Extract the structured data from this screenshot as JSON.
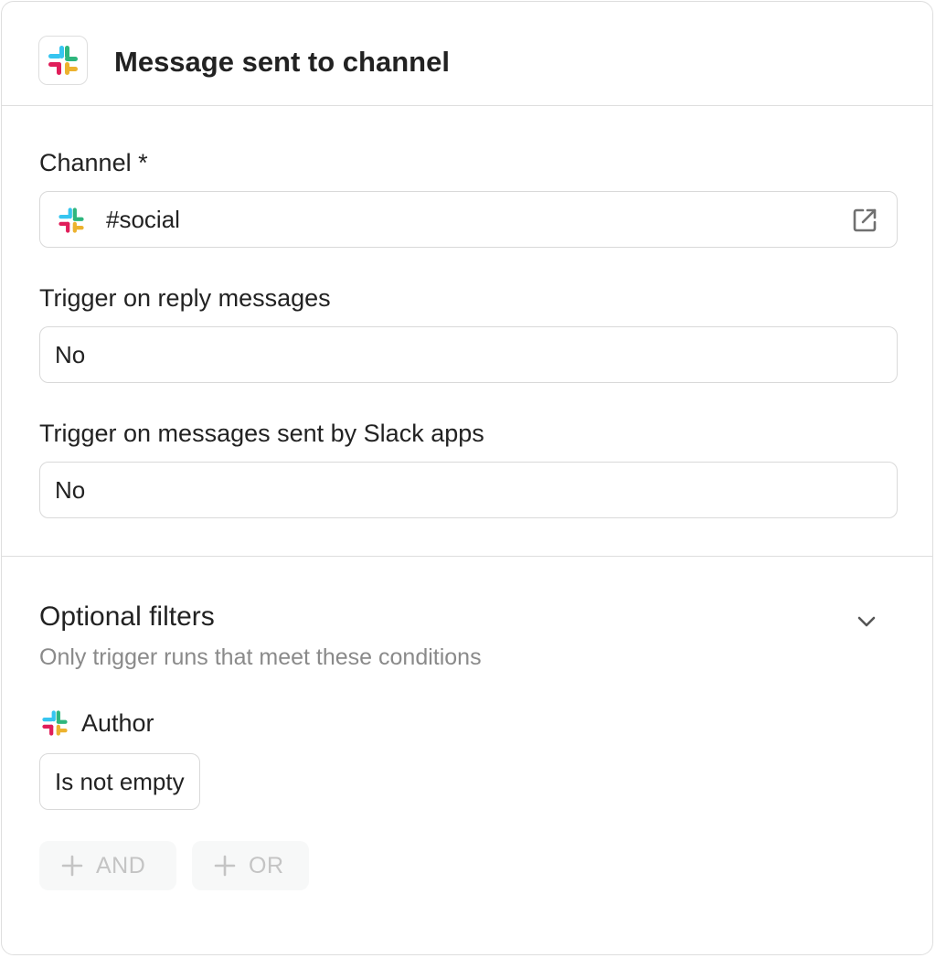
{
  "header": {
    "title": "Message sent to channel",
    "app_icon": "slack-icon"
  },
  "fields": {
    "channel": {
      "label": "Channel *",
      "value": "#social",
      "icon": "slack-icon",
      "action_icon": "open-external-icon"
    },
    "reply_messages": {
      "label": "Trigger on reply messages",
      "value": "No"
    },
    "slack_apps": {
      "label": "Trigger on messages sent by Slack apps",
      "value": "No"
    }
  },
  "filters": {
    "title": "Optional filters",
    "subtitle": "Only trigger runs that meet these conditions",
    "toggle_icon": "chevron-down-icon",
    "items": [
      {
        "label": "Author",
        "icon": "slack-icon",
        "condition": "Is not empty"
      }
    ],
    "and_label": "AND",
    "or_label": "OR"
  },
  "colors": {
    "slack_blue": "#36C5F0",
    "slack_green": "#2EB67D",
    "slack_red": "#E01E5A",
    "slack_yellow": "#ECB22E",
    "border": "#DEDEDE",
    "muted_text": "#8A8A8A",
    "disabled_text": "#C4C4C4"
  }
}
